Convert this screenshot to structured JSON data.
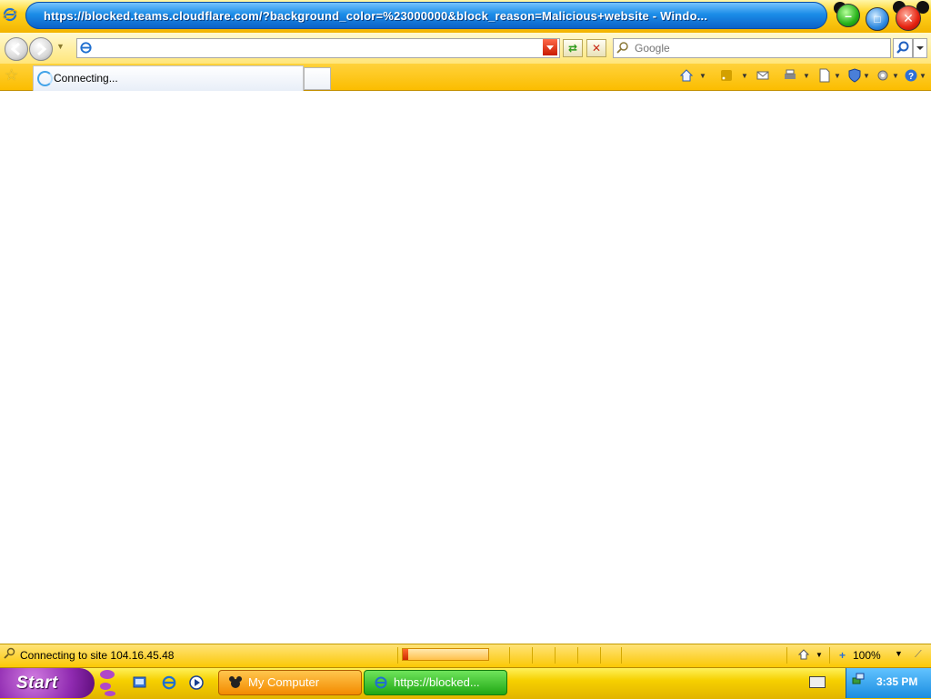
{
  "window": {
    "title": "https://blocked.teams.cloudflare.com/?background_color=%23000000&block_reason=Malicious+website - Windo...",
    "controls": {
      "minimize": "–",
      "maximize": "□",
      "close": "✕"
    }
  },
  "navbar": {
    "back_icon": "back-arrow-icon",
    "forward_icon": "forward-arrow-icon",
    "address_value": "",
    "refresh_glyph": "⇄",
    "stop_glyph": "✕",
    "search_placeholder": "Google"
  },
  "tabs": [
    {
      "label": "Connecting...",
      "state": "loading"
    }
  ],
  "command_bar": {
    "items": [
      "home-icon",
      "feeds-icon",
      "read-mail-icon",
      "print-icon",
      "page-icon",
      "safety-icon",
      "tools-icon",
      "help-icon"
    ]
  },
  "status": {
    "text": "Connecting to site 104.16.45.48",
    "progress": 0.06,
    "zoom": "100%"
  },
  "taskbar": {
    "start_label": "Start",
    "tasks": [
      {
        "label": "My Computer",
        "active": false
      },
      {
        "label": "https://blocked...",
        "active": true
      }
    ],
    "clock": "3:35 PM"
  },
  "colors": {
    "title_blue": "#1b8de8",
    "chrome_yellow": "#fbc700",
    "start_purple": "#8f2ab0",
    "task_orange": "#f38a00",
    "task_green": "#20a714"
  }
}
